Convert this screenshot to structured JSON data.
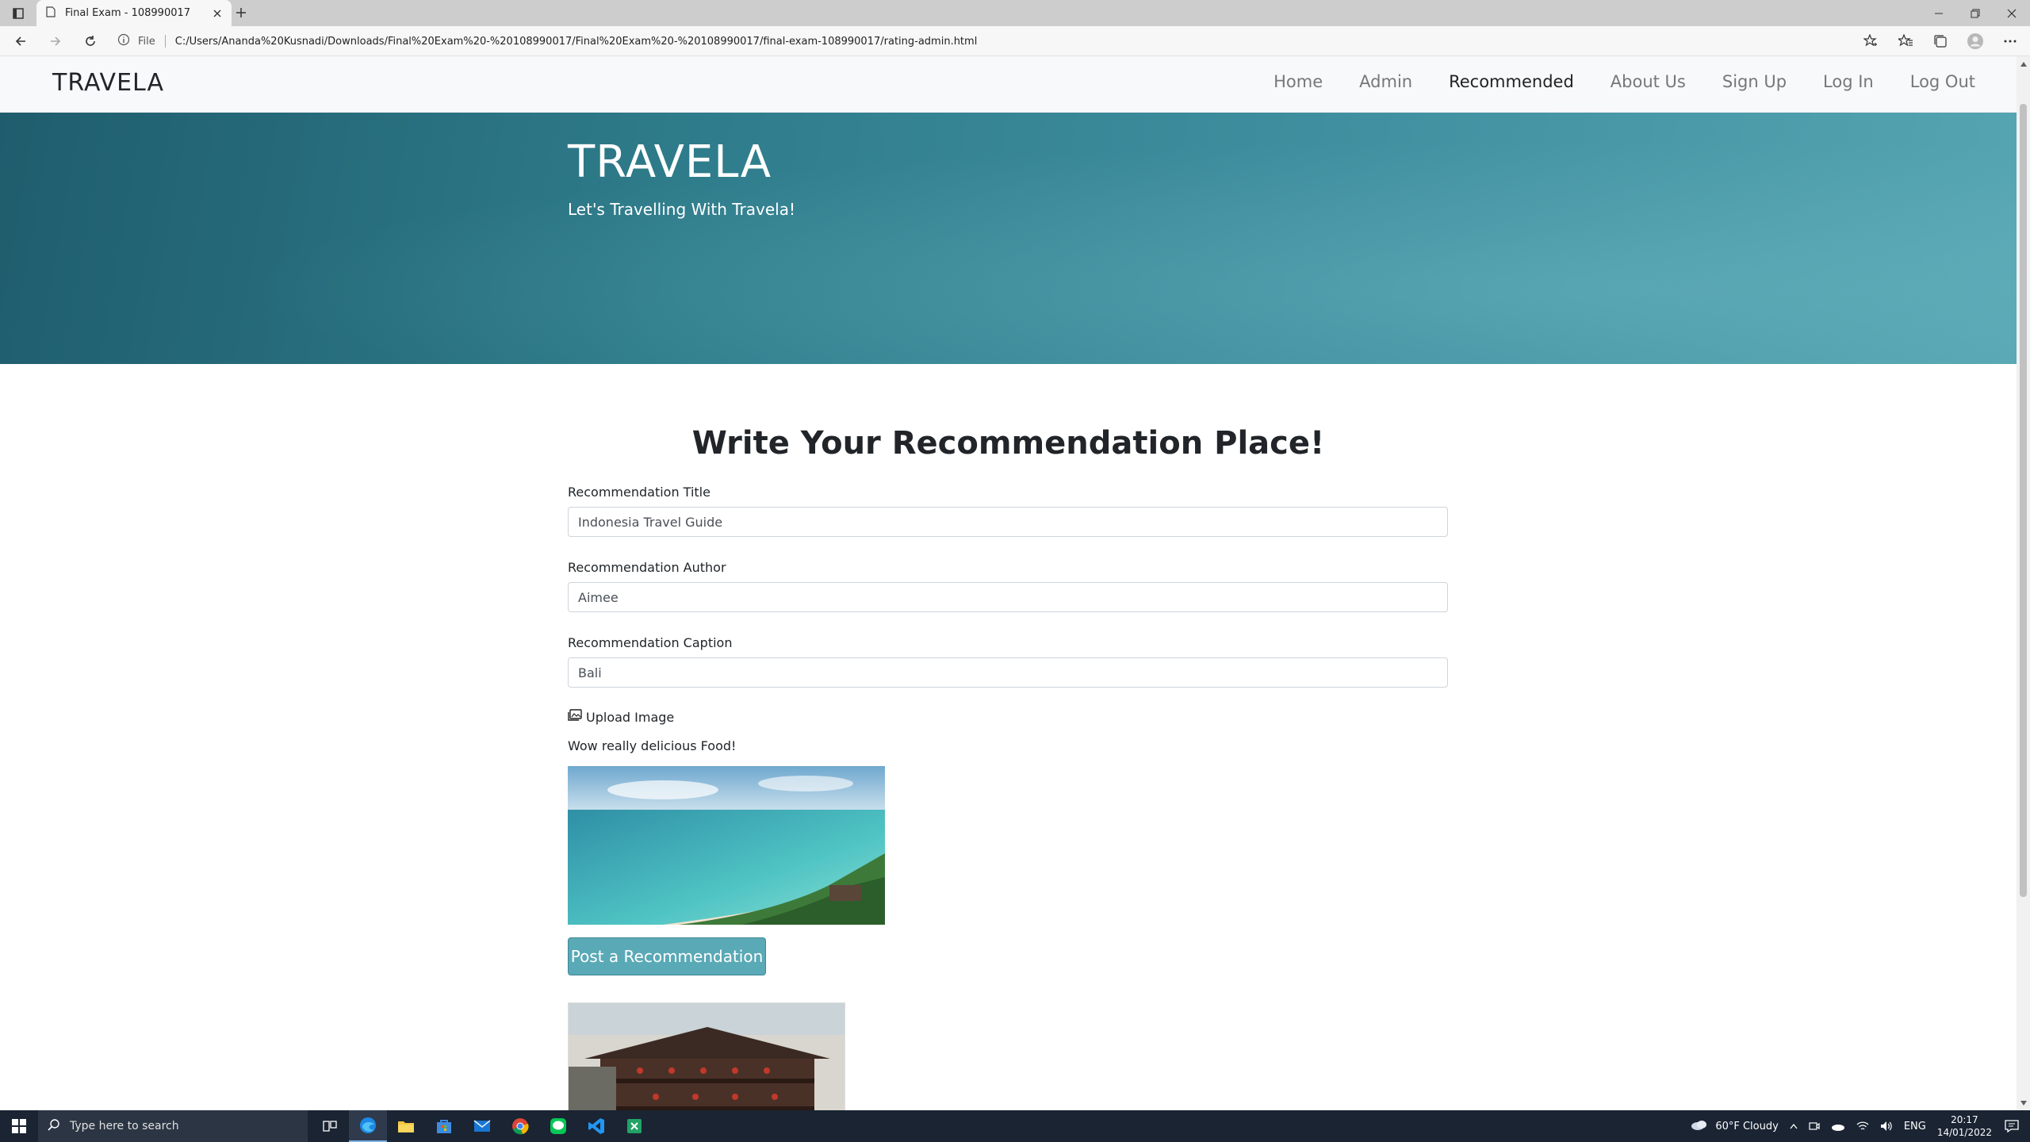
{
  "browser": {
    "tab_title": "Final Exam - 108990017",
    "url_scheme_label": "File",
    "url": "C:/Users/Ananda%20Kusnadi/Downloads/Final%20Exam%20-%20108990017/Final%20Exam%20-%20108990017/final-exam-108990017/rating-admin.html"
  },
  "site": {
    "brand": "TRAVELA",
    "nav": [
      {
        "label": "Home"
      },
      {
        "label": "Admin"
      },
      {
        "label": "Recommended"
      },
      {
        "label": "About Us"
      },
      {
        "label": "Sign Up"
      },
      {
        "label": "Log In"
      },
      {
        "label": "Log Out"
      }
    ],
    "active_nav": "Recommended"
  },
  "hero": {
    "title": "TRAVELA",
    "subtitle": "Let's Travelling With Travela!"
  },
  "form": {
    "heading": "Write Your Recommendation Place!",
    "title_label": "Recommendation Title",
    "title_value": "Indonesia Travel Guide",
    "author_label": "Recommendation Author",
    "author_value": "Aimee",
    "caption_label": "Recommendation Caption",
    "caption_value": "Bali",
    "upload_label": "Upload Image",
    "caption_preview": "Wow really delicious Food!",
    "submit_label": "Post a Recommendation"
  },
  "taskbar": {
    "search_placeholder": "Type here to search",
    "weather": "60°F  Cloudy",
    "language": "ENG",
    "time": "20:17",
    "date": "14/01/2022"
  },
  "colors": {
    "hero_start": "#1f5d6d",
    "hero_end": "#55a5b2",
    "button": "#5aa9b6"
  }
}
